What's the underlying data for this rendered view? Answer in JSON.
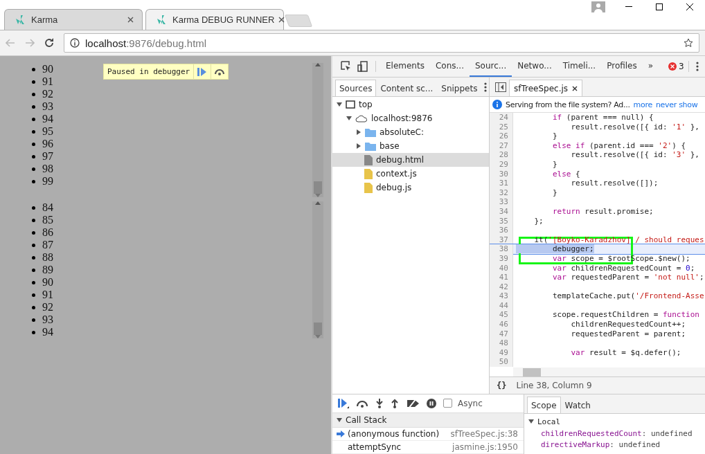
{
  "browser_tabs": [
    {
      "title": "Karma",
      "selected": false
    },
    {
      "title": "Karma DEBUG RUNNER",
      "selected": true
    }
  ],
  "address_bar": {
    "host": "localhost",
    "rest": ":9876/debug.html"
  },
  "page": {
    "paused_banner": "Paused in debugger",
    "lists": [
      {
        "items": [
          "90",
          "91",
          "92",
          "93",
          "94",
          "95",
          "96",
          "97",
          "98",
          "99"
        ]
      },
      {
        "items": [
          "84",
          "85",
          "86",
          "87",
          "88",
          "89",
          "90",
          "91",
          "92",
          "93",
          "94"
        ]
      }
    ]
  },
  "devtools": {
    "tabs": [
      {
        "label": "Elements",
        "selected": false
      },
      {
        "label": "Cons...",
        "selected": false
      },
      {
        "label": "Sourc...",
        "selected": true
      },
      {
        "label": "Netwo...",
        "selected": false
      },
      {
        "label": "Timeli...",
        "selected": false
      },
      {
        "label": "Profiles",
        "selected": false
      }
    ],
    "more": "»",
    "error_count": "3",
    "navigator_tabs": [
      {
        "label": "Sources",
        "selected": true
      },
      {
        "label": "Content sc...",
        "selected": false
      },
      {
        "label": "Snippets",
        "selected": false
      }
    ],
    "tree": [
      {
        "kind": "frame",
        "label": "top",
        "expanded": true,
        "selected": false,
        "children": [
          {
            "kind": "domain",
            "label": "localhost:9876",
            "expanded": true,
            "selected": false,
            "children": [
              {
                "kind": "folder",
                "label": "absoluteC:",
                "expanded": false,
                "selected": false
              },
              {
                "kind": "folder",
                "label": "base",
                "expanded": false,
                "selected": false
              },
              {
                "kind": "html",
                "label": "debug.html",
                "selected": true
              },
              {
                "kind": "js",
                "label": "context.js",
                "selected": false
              },
              {
                "kind": "js",
                "label": "debug.js",
                "selected": false
              }
            ]
          }
        ]
      }
    ],
    "editor_tab": "sfTreeSpec.js",
    "infobar": {
      "message": "Serving from the file system? Ad...",
      "links": [
        "more",
        "never show"
      ]
    },
    "code": [
      {
        "n": "24",
        "selected": false,
        "tokens": [
          {
            "kind": "keyword",
            "text": "        if"
          },
          {
            "kind": "plain",
            "text": " (parent === null) {"
          }
        ]
      },
      {
        "n": "25",
        "selected": false,
        "tokens": [
          {
            "kind": "plain",
            "text": "            result.resolve([{ id: "
          },
          {
            "kind": "string",
            "text": "'1'"
          },
          {
            "kind": "plain",
            "text": " },"
          }
        ]
      },
      {
        "n": "26",
        "selected": false,
        "tokens": [
          {
            "kind": "plain",
            "text": "        }"
          }
        ]
      },
      {
        "n": "27",
        "selected": false,
        "tokens": [
          {
            "kind": "keyword",
            "text": "        else if"
          },
          {
            "kind": "plain",
            "text": " (parent.id === "
          },
          {
            "kind": "string",
            "text": "'2'"
          },
          {
            "kind": "plain",
            "text": ") {"
          }
        ]
      },
      {
        "n": "28",
        "selected": false,
        "tokens": [
          {
            "kind": "plain",
            "text": "            result.resolve([{ id: "
          },
          {
            "kind": "string",
            "text": "'3'"
          },
          {
            "kind": "plain",
            "text": " },"
          }
        ]
      },
      {
        "n": "29",
        "selected": false,
        "tokens": [
          {
            "kind": "plain",
            "text": "        }"
          }
        ]
      },
      {
        "n": "30",
        "selected": false,
        "tokens": [
          {
            "kind": "keyword",
            "text": "        else"
          },
          {
            "kind": "plain",
            "text": " {"
          }
        ]
      },
      {
        "n": "31",
        "selected": false,
        "tokens": [
          {
            "kind": "plain",
            "text": "            result.resolve([]);"
          }
        ]
      },
      {
        "n": "32",
        "selected": false,
        "tokens": [
          {
            "kind": "plain",
            "text": "        }"
          }
        ]
      },
      {
        "n": "33",
        "selected": false
      },
      {
        "n": "34",
        "selected": false,
        "tokens": [
          {
            "kind": "keyword",
            "text": "        return"
          },
          {
            "kind": "plain",
            "text": " result.promise;"
          }
        ]
      },
      {
        "n": "35",
        "selected": false,
        "tokens": [
          {
            "kind": "plain",
            "text": "    };"
          }
        ]
      },
      {
        "n": "36",
        "selected": false
      },
      {
        "n": "37",
        "selected": false,
        "tokens": [
          {
            "kind": "plain",
            "text": "    it("
          },
          {
            "kind": "string",
            "text": "'[Boyko-Karadzhov] / should reques"
          }
        ]
      },
      {
        "n": "38",
        "selected": true,
        "tokens": [
          {
            "kind": "highlight",
            "text": "        debugger;"
          }
        ]
      },
      {
        "n": "39",
        "selected": false,
        "tokens": [
          {
            "kind": "keyword",
            "text": "        var"
          },
          {
            "kind": "plain",
            "text": " scope = $rootScope.$new();"
          }
        ]
      },
      {
        "n": "40",
        "selected": false,
        "tokens": [
          {
            "kind": "keyword",
            "text": "        var"
          },
          {
            "kind": "plain",
            "text": " childrenRequestedCount = "
          },
          {
            "kind": "number",
            "text": "0"
          },
          {
            "kind": "plain",
            "text": ";"
          }
        ]
      },
      {
        "n": "41",
        "selected": false,
        "tokens": [
          {
            "kind": "keyword",
            "text": "        var"
          },
          {
            "kind": "plain",
            "text": " requestedParent = "
          },
          {
            "kind": "string",
            "text": "'not null'"
          },
          {
            "kind": "plain",
            "text": ";"
          }
        ]
      },
      {
        "n": "42",
        "selected": false
      },
      {
        "n": "43",
        "selected": false,
        "tokens": [
          {
            "kind": "plain",
            "text": "        templateCache.put("
          },
          {
            "kind": "string",
            "text": "'/Frontend-Asse"
          }
        ]
      },
      {
        "n": "44",
        "selected": false
      },
      {
        "n": "45",
        "selected": false,
        "tokens": [
          {
            "kind": "plain",
            "text": "        scope.requestChildren = "
          },
          {
            "kind": "keyword",
            "text": "function"
          }
        ]
      },
      {
        "n": "46",
        "selected": false,
        "tokens": [
          {
            "kind": "plain",
            "text": "            childrenRequestedCount++;"
          }
        ]
      },
      {
        "n": "47",
        "selected": false,
        "tokens": [
          {
            "kind": "plain",
            "text": "            requestedParent = parent;"
          }
        ]
      },
      {
        "n": "48",
        "selected": false
      },
      {
        "n": "49",
        "selected": false,
        "tokens": [
          {
            "kind": "keyword",
            "text": "            var"
          },
          {
            "kind": "plain",
            "text": " result = $q.defer();"
          }
        ]
      },
      {
        "n": "50",
        "selected": false
      }
    ],
    "pretty_print": "{}",
    "status": "Line 38, Column 9",
    "async": {
      "label": "Async",
      "checked": false
    },
    "call_stack": {
      "title": "Call Stack",
      "expanded": true,
      "frames": [
        {
          "name": "(anonymous function)",
          "location": "sfTreeSpec.js:38",
          "current": true
        },
        {
          "name": "attemptSync",
          "location": "jasmine.js:1950",
          "current": false
        }
      ]
    },
    "scope_tabs": [
      {
        "label": "Scope",
        "selected": true
      },
      {
        "label": "Watch",
        "selected": false
      }
    ],
    "scope": {
      "title": "Local",
      "expanded": true,
      "separator": ":",
      "vars": [
        {
          "name": "childrenRequestedCount",
          "value": "undefined"
        },
        {
          "name": "directiveMarkup",
          "value": "undefined"
        }
      ]
    }
  }
}
